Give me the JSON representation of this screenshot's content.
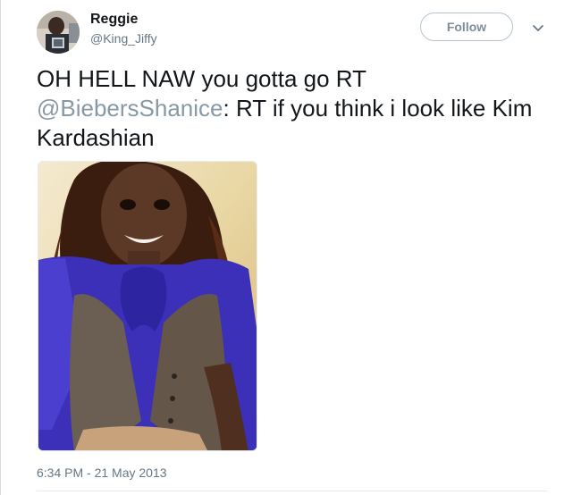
{
  "author": {
    "display_name": "Reggie",
    "screen_name": "@King_Jiffy"
  },
  "follow_button": {
    "label": "Follow"
  },
  "menu": {
    "icon": "chevron-down-icon"
  },
  "tweet": {
    "text_before_mention": "OH HELL NAW you gotta go  RT ",
    "mention": "@BiebersShanice",
    "text_after_mention": ": RT if you think i look like Kim Kardashian",
    "timestamp": "6:34 PM - 21 May 2013"
  },
  "colors": {
    "text": "#14171a",
    "secondary": "#657786",
    "mention": "#8899a6",
    "follow_border": "#b8c3cc"
  }
}
